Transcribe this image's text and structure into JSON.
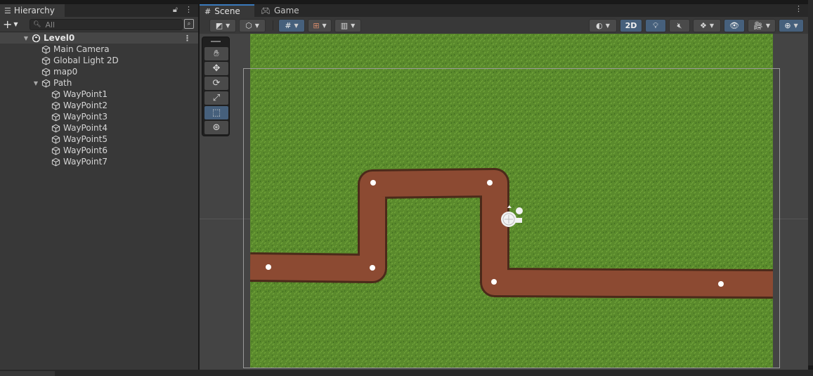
{
  "hierarchy": {
    "tab_label": "Hierarchy",
    "search_placeholder": "All",
    "scene_name": "Level0",
    "items": [
      {
        "label": "Main Camera",
        "depth": 1
      },
      {
        "label": "Global Light 2D",
        "depth": 1
      },
      {
        "label": "map0",
        "depth": 1
      },
      {
        "label": "Path",
        "depth": 1,
        "expanded": true
      },
      {
        "label": "WayPoint1",
        "depth": 2
      },
      {
        "label": "WayPoint2",
        "depth": 2
      },
      {
        "label": "WayPoint3",
        "depth": 2
      },
      {
        "label": "WayPoint4",
        "depth": 2
      },
      {
        "label": "WayPoint5",
        "depth": 2
      },
      {
        "label": "WayPoint6",
        "depth": 2
      },
      {
        "label": "WayPoint7",
        "depth": 2
      }
    ]
  },
  "scene": {
    "tabs": [
      {
        "label": "Scene",
        "active": true
      },
      {
        "label": "Game",
        "active": false
      }
    ],
    "toolbar": {
      "mode_2d_label": "2D"
    }
  },
  "colors": {
    "accent": "#46607c",
    "tab_highlight": "#3a79bb",
    "grass": "#5a8a2c",
    "path": "#8c4a32"
  },
  "icons": {
    "tools": [
      "hand-icon",
      "move-icon",
      "rotate-icon",
      "scale-icon",
      "rect-icon",
      "transform-icon"
    ]
  }
}
